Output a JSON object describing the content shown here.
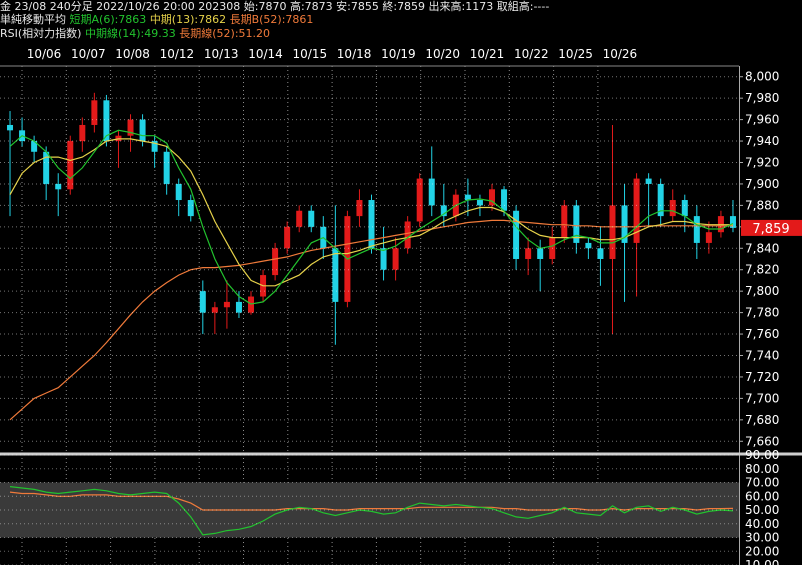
{
  "header": {
    "line1": "金 23/08 240分足 2022/10/26 20:00 202308 始:7870 高:7873 安:7855 終:7859 出来高:1173 取組高:----",
    "line2_title": "単純移動平均",
    "line2_a": "短期A(6):7863",
    "line2_b": "中期(13):7862",
    "line2_c": "長期B(52):7861",
    "line3_title": "RSI(相対力指数)",
    "line3_a": "中期線(14):49.33",
    "line3_b": "長期線(52):51.20"
  },
  "colors": {
    "up": "#e31a1a",
    "down": "#22d3e6",
    "sma6": "#22c32e",
    "sma13": "#e6d24a",
    "sma52": "#f07a3a",
    "rsi14": "#22c32e",
    "rsi52": "#f07a3a",
    "last_price_bg": "#e31a1a"
  },
  "chart_data": [
    {
      "type": "candlestick",
      "x_labels": [
        "10/06",
        "10/07",
        "10/08",
        "10/12",
        "10/13",
        "10/14",
        "10/15",
        "10/18",
        "10/19",
        "10/20",
        "10/21",
        "10/22",
        "10/25",
        "10/26"
      ],
      "ylim": [
        7650,
        8010
      ],
      "y_ticks": [
        "8,000",
        "7,980",
        "7,960",
        "7,940",
        "7,920",
        "7,900",
        "7,880",
        "7,860",
        "7,840",
        "7,820",
        "7,800",
        "7,780",
        "7,760",
        "7,740",
        "7,720",
        "7,700",
        "7,680",
        "7,660"
      ],
      "last_price_label": "7,859",
      "series_labels": [
        "短期A(6)",
        "中期(13)",
        "長期B(52)"
      ],
      "ohlc": [
        [
          7955,
          7968,
          7870,
          7950
        ],
        [
          7950,
          7962,
          7935,
          7940
        ],
        [
          7940,
          7945,
          7920,
          7930
        ],
        [
          7930,
          7935,
          7885,
          7900
        ],
        [
          7900,
          7910,
          7870,
          7895
        ],
        [
          7895,
          7945,
          7890,
          7940
        ],
        [
          7940,
          7962,
          7930,
          7955
        ],
        [
          7955,
          7985,
          7948,
          7978
        ],
        [
          7978,
          7983,
          7935,
          7940
        ],
        [
          7940,
          7950,
          7915,
          7945
        ],
        [
          7945,
          7965,
          7930,
          7960
        ],
        [
          7960,
          7965,
          7935,
          7940
        ],
        [
          7940,
          7945,
          7915,
          7930
        ],
        [
          7930,
          7935,
          7890,
          7900
        ],
        [
          7900,
          7905,
          7870,
          7885
        ],
        [
          7885,
          7890,
          7865,
          7870
        ],
        [
          7800,
          7810,
          7760,
          7780
        ],
        [
          7780,
          7790,
          7760,
          7785
        ],
        [
          7785,
          7810,
          7765,
          7790
        ],
        [
          7790,
          7800,
          7775,
          7780
        ],
        [
          7780,
          7800,
          7778,
          7795
        ],
        [
          7795,
          7820,
          7790,
          7815
        ],
        [
          7815,
          7845,
          7810,
          7840
        ],
        [
          7840,
          7865,
          7835,
          7860
        ],
        [
          7860,
          7880,
          7855,
          7875
        ],
        [
          7875,
          7880,
          7855,
          7860
        ],
        [
          7860,
          7870,
          7830,
          7840
        ],
        [
          7840,
          7880,
          7750,
          7790
        ],
        [
          7790,
          7875,
          7785,
          7870
        ],
        [
          7870,
          7895,
          7860,
          7885
        ],
        [
          7885,
          7890,
          7835,
          7840
        ],
        [
          7840,
          7860,
          7810,
          7820
        ],
        [
          7820,
          7850,
          7810,
          7840
        ],
        [
          7840,
          7870,
          7835,
          7865
        ],
        [
          7865,
          7910,
          7860,
          7905
        ],
        [
          7905,
          7935,
          7870,
          7880
        ],
        [
          7880,
          7900,
          7860,
          7870
        ],
        [
          7870,
          7895,
          7865,
          7890
        ],
        [
          7890,
          7905,
          7870,
          7885
        ],
        [
          7885,
          7890,
          7870,
          7880
        ],
        [
          7880,
          7900,
          7875,
          7895
        ],
        [
          7895,
          7898,
          7870,
          7875
        ],
        [
          7875,
          7880,
          7820,
          7830
        ],
        [
          7830,
          7850,
          7815,
          7840
        ],
        [
          7840,
          7848,
          7800,
          7830
        ],
        [
          7830,
          7860,
          7825,
          7850
        ],
        [
          7850,
          7885,
          7845,
          7880
        ],
        [
          7880,
          7885,
          7835,
          7845
        ],
        [
          7845,
          7850,
          7830,
          7840
        ],
        [
          7840,
          7860,
          7805,
          7830
        ],
        [
          7830,
          7955,
          7760,
          7880
        ],
        [
          7880,
          7900,
          7790,
          7845
        ],
        [
          7845,
          7910,
          7795,
          7905
        ],
        [
          7905,
          7910,
          7860,
          7900
        ],
        [
          7900,
          7905,
          7860,
          7870
        ],
        [
          7870,
          7895,
          7865,
          7885
        ],
        [
          7885,
          7890,
          7855,
          7870
        ],
        [
          7870,
          7880,
          7830,
          7845
        ],
        [
          7845,
          7865,
          7835,
          7855
        ],
        [
          7855,
          7875,
          7850,
          7870
        ],
        [
          7870,
          7885,
          7855,
          7859
        ]
      ],
      "sma6": [
        7935,
        7945,
        7940,
        7930,
        7915,
        7905,
        7915,
        7930,
        7945,
        7950,
        7948,
        7945,
        7945,
        7938,
        7915,
        7895,
        7860,
        7830,
        7808,
        7795,
        7788,
        7790,
        7800,
        7815,
        7830,
        7845,
        7850,
        7840,
        7830,
        7835,
        7840,
        7838,
        7842,
        7850,
        7858,
        7865,
        7872,
        7880,
        7885,
        7886,
        7884,
        7875,
        7860,
        7848,
        7840,
        7842,
        7848,
        7852,
        7850,
        7845,
        7845,
        7850,
        7860,
        7870,
        7875,
        7875,
        7870,
        7862,
        7858,
        7858,
        7863
      ],
      "sma13": [
        7890,
        7910,
        7920,
        7925,
        7925,
        7922,
        7925,
        7932,
        7940,
        7942,
        7942,
        7940,
        7938,
        7935,
        7925,
        7912,
        7890,
        7865,
        7845,
        7825,
        7810,
        7805,
        7805,
        7810,
        7815,
        7825,
        7832,
        7835,
        7835,
        7838,
        7842,
        7845,
        7848,
        7850,
        7852,
        7858,
        7865,
        7870,
        7875,
        7878,
        7878,
        7874,
        7866,
        7858,
        7852,
        7850,
        7850,
        7850,
        7850,
        7848,
        7848,
        7850,
        7855,
        7860,
        7862,
        7865,
        7865,
        7863,
        7862,
        7862,
        7862
      ],
      "sma52": [
        7680,
        7690,
        7700,
        7705,
        7710,
        7720,
        7730,
        7740,
        7752,
        7765,
        7778,
        7790,
        7800,
        7808,
        7815,
        7820,
        7822,
        7822,
        7823,
        7824,
        7826,
        7828,
        7830,
        7832,
        7835,
        7838,
        7840,
        7842,
        7844,
        7846,
        7848,
        7850,
        7852,
        7854,
        7856,
        7858,
        7860,
        7862,
        7864,
        7865,
        7866,
        7866,
        7865,
        7864,
        7863,
        7862,
        7862,
        7861,
        7861,
        7860,
        7860,
        7860,
        7860,
        7861,
        7861,
        7861,
        7861,
        7861,
        7861,
        7861,
        7861
      ]
    },
    {
      "type": "line",
      "ylim": [
        10,
        90
      ],
      "y_ticks": [
        "90.00",
        "80.00",
        "70.00",
        "60.00",
        "50.00",
        "40.00",
        "30.00",
        "20.00",
        "10.00"
      ],
      "series_labels": [
        "中期線(14)",
        "長期線(52)"
      ],
      "rsi14": [
        67,
        66,
        65,
        63,
        62,
        63,
        64,
        65,
        64,
        62,
        61,
        62,
        63,
        62,
        55,
        45,
        32,
        33,
        35,
        36,
        38,
        42,
        47,
        50,
        52,
        51,
        48,
        46,
        48,
        50,
        49,
        47,
        48,
        52,
        55,
        54,
        53,
        54,
        53,
        52,
        51,
        48,
        45,
        44,
        46,
        48,
        52,
        48,
        47,
        46,
        53,
        48,
        52,
        53,
        49,
        52,
        50,
        47,
        49,
        50,
        49.33
      ],
      "rsi52": [
        63,
        62,
        62,
        61,
        60,
        60,
        61,
        61,
        61,
        60,
        60,
        60,
        60,
        60,
        58,
        55,
        50,
        50,
        50,
        50,
        50,
        50,
        50,
        51,
        51,
        51,
        51,
        50,
        50,
        51,
        51,
        51,
        51,
        51,
        52,
        52,
        52,
        52,
        52,
        52,
        52,
        51,
        51,
        50,
        50,
        50,
        51,
        51,
        50,
        50,
        51,
        50,
        51,
        51,
        51,
        51,
        51,
        50,
        51,
        51,
        51.2
      ]
    }
  ]
}
